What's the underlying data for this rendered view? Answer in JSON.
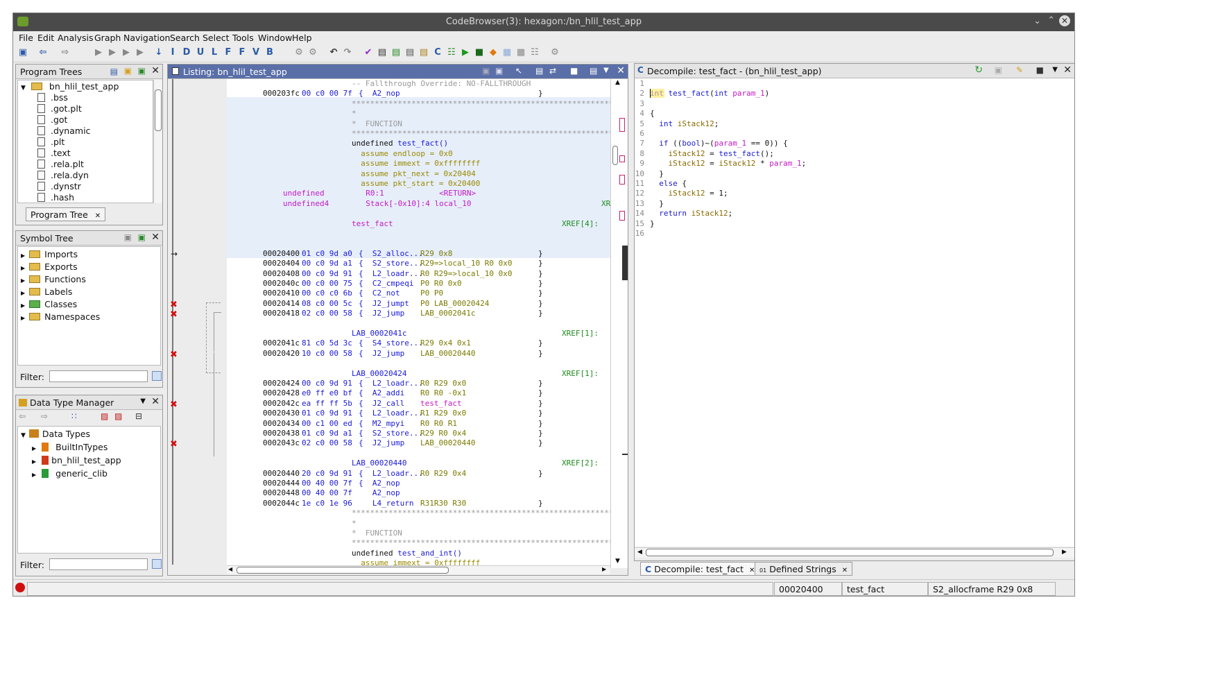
{
  "window": {
    "title": "CodeBrowser(3): hexagon:/bn_hlil_test_app"
  },
  "menu": [
    "File",
    "Edit",
    "Analysis",
    "Graph",
    "Navigation",
    "Search",
    "Select",
    "Tools",
    "Window",
    "Help"
  ],
  "program_trees": {
    "title": "Program Trees",
    "root": "bn_hlil_test_app",
    "items": [
      ".bss",
      ".got.plt",
      ".got",
      ".dynamic",
      ".plt",
      ".text",
      ".rela.plt",
      ".rela.dyn",
      ".dynstr",
      ".hash"
    ],
    "tab": "Program Tree"
  },
  "symbol_tree": {
    "title": "Symbol Tree",
    "items": [
      "Imports",
      "Exports",
      "Functions",
      "Labels",
      "Classes",
      "Namespaces"
    ],
    "filter_label": "Filter:"
  },
  "data_type_manager": {
    "title": "Data Type Manager",
    "root": "Data Types",
    "items": [
      "BuiltInTypes",
      "bn_hlil_test_app",
      "generic_clib"
    ],
    "filter_label": "Filter:"
  },
  "listing": {
    "title": "Listing:  bn_hlil_test_app",
    "lines": [
      {
        "a": "",
        "b": "",
        "m": "-- Fallthrough Override: NO-FALLTHROUGH",
        "o": "",
        "t": "gray"
      },
      {
        "a": "000203fc",
        "b": "00 c0 00 7f",
        "m": "{  A2_nop",
        "o": "",
        "t": "ins",
        "e": "}"
      },
      {
        "a": "",
        "b": "",
        "m": "**************************************************************",
        "o": "",
        "t": "star"
      },
      {
        "a": "",
        "b": "",
        "m": "*",
        "o": "",
        "t": "star"
      },
      {
        "a": "",
        "b": "",
        "m": "*  FUNCTION",
        "o": "",
        "t": "star"
      },
      {
        "a": "",
        "b": "",
        "m": "**************************************************************",
        "o": "",
        "t": "star"
      },
      {
        "a": "",
        "b": "",
        "m": "undefined test_fact()",
        "o": "",
        "t": "sig"
      },
      {
        "a": "",
        "b": "",
        "m": "  assume endloop = 0x0",
        "o": "",
        "t": "assume"
      },
      {
        "a": "",
        "b": "",
        "m": "  assume immext = 0xffffffff",
        "o": "",
        "t": "assume"
      },
      {
        "a": "",
        "b": "",
        "m": "  assume pkt_next = 0x20404",
        "o": "",
        "t": "assume"
      },
      {
        "a": "",
        "b": "",
        "m": "  assume pkt_start = 0x20400",
        "o": "",
        "t": "assume"
      },
      {
        "a": "",
        "b": "",
        "m": "undefined         R0:1            <RETURN>",
        "o": "",
        "t": "var"
      },
      {
        "a": "",
        "b": "",
        "m": "undefined4        Stack[-0x10]:4 local_10",
        "o": "XR",
        "t": "var"
      },
      {
        "a": "",
        "b": "",
        "m": "",
        "o": "",
        "t": "blank"
      },
      {
        "a": "",
        "b": "",
        "m": "test_fact",
        "o": "XREF[4]:",
        "t": "label"
      },
      {
        "a": "",
        "b": "",
        "m": "",
        "o": "",
        "t": "blank"
      },
      {
        "a": "",
        "b": "",
        "m": "",
        "o": "",
        "t": "blank"
      },
      {
        "a": "00020400",
        "b": "01 c0 9d a0",
        "m": "{  S2_alloc...",
        "o": "R29 0x8",
        "t": "ins",
        "e": "}"
      },
      {
        "a": "00020404",
        "b": "00 c0 9d a1",
        "m": "{  S2_store...",
        "o": "R29=>local_10 R0 0x0",
        "t": "ins",
        "e": "}"
      },
      {
        "a": "00020408",
        "b": "00 c0 9d 91",
        "m": "{  L2_loadr...",
        "o": "R0 R29=>local_10 0x0",
        "t": "ins",
        "e": "}"
      },
      {
        "a": "0002040c",
        "b": "00 c0 00 75",
        "m": "{  C2_cmpeqi",
        "o": "P0 R0 0x0",
        "t": "ins",
        "e": "}"
      },
      {
        "a": "00020410",
        "b": "00 c0 c0 6b",
        "m": "{  C2_not",
        "o": "P0 P0",
        "t": "ins",
        "e": "}"
      },
      {
        "a": "00020414",
        "b": "08 c0 00 5c",
        "m": "{  J2_jumpt",
        "o": "P0 LAB_00020424",
        "t": "ins",
        "e": "}"
      },
      {
        "a": "00020418",
        "b": "02 c0 00 58",
        "m": "{  J2_jump",
        "o": "LAB_0002041c",
        "t": "ins",
        "e": "}"
      },
      {
        "a": "",
        "b": "",
        "m": "",
        "o": "",
        "t": "blank"
      },
      {
        "a": "",
        "b": "",
        "m": "LAB_0002041c",
        "o": "XREF[1]:",
        "t": "label"
      },
      {
        "a": "0002041c",
        "b": "81 c0 5d 3c",
        "m": "{  S4_store...",
        "o": "R29 0x4 0x1",
        "t": "ins",
        "e": "}"
      },
      {
        "a": "00020420",
        "b": "10 c0 00 58",
        "m": "{  J2_jump",
        "o": "LAB_00020440",
        "t": "ins",
        "e": "}"
      },
      {
        "a": "",
        "b": "",
        "m": "",
        "o": "",
        "t": "blank"
      },
      {
        "a": "",
        "b": "",
        "m": "LAB_00020424",
        "o": "XREF[1]:",
        "t": "label"
      },
      {
        "a": "00020424",
        "b": "00 c0 9d 91",
        "m": "{  L2_loadr...",
        "o": "R0 R29 0x0",
        "t": "ins",
        "e": "}"
      },
      {
        "a": "00020428",
        "b": "e0 ff e0 bf",
        "m": "{  A2_addi",
        "o": "R0 R0 -0x1",
        "t": "ins",
        "e": "}"
      },
      {
        "a": "0002042c",
        "b": "ea ff ff 5b",
        "m": "{  J2_call",
        "o": "test_fact",
        "t": "call",
        "e": "}"
      },
      {
        "a": "00020430",
        "b": "01 c0 9d 91",
        "m": "{  L2_loadr...",
        "o": "R1 R29 0x0",
        "t": "ins",
        "e": "}"
      },
      {
        "a": "00020434",
        "b": "00 c1 00 ed",
        "m": "{  M2_mpyi",
        "o": "R0 R0 R1",
        "t": "ins",
        "e": "}"
      },
      {
        "a": "00020438",
        "b": "01 c0 9d a1",
        "m": "{  S2_store...",
        "o": "R29 R0 0x4",
        "t": "ins",
        "e": "}"
      },
      {
        "a": "0002043c",
        "b": "02 c0 00 58",
        "m": "{  J2_jump",
        "o": "LAB_00020440",
        "t": "ins",
        "e": "}"
      },
      {
        "a": "",
        "b": "",
        "m": "",
        "o": "",
        "t": "blank"
      },
      {
        "a": "",
        "b": "",
        "m": "LAB_00020440",
        "o": "XREF[2]:",
        "t": "label"
      },
      {
        "a": "00020440",
        "b": "20 c0 9d 91",
        "m": "{  L2_loadr...",
        "o": "R0 R29 0x4",
        "t": "ins",
        "e": "}"
      },
      {
        "a": "00020444",
        "b": "00 40 00 7f",
        "m": "{  A2_nop",
        "o": "",
        "t": "ins",
        "e": ""
      },
      {
        "a": "00020448",
        "b": "00 40 00 7f",
        "m": "   A2_nop",
        "o": "",
        "t": "ins",
        "e": ""
      },
      {
        "a": "0002044c",
        "b": "1e c0 1e 96",
        "m": "   L4_return",
        "o": "R31R30 R30",
        "t": "ins",
        "e": "}"
      },
      {
        "a": "",
        "b": "",
        "m": "**************************************************************",
        "o": "",
        "t": "star"
      },
      {
        "a": "",
        "b": "",
        "m": "*",
        "o": "",
        "t": "star"
      },
      {
        "a": "",
        "b": "",
        "m": "*  FUNCTION",
        "o": "",
        "t": "star"
      },
      {
        "a": "",
        "b": "",
        "m": "**************************************************************",
        "o": "",
        "t": "star"
      },
      {
        "a": "",
        "b": "",
        "m": "undefined test_and_int()",
        "o": "",
        "t": "sig2"
      },
      {
        "a": "",
        "b": "",
        "m": "  assume immext = 0xffffffff",
        "o": "",
        "t": "assume"
      }
    ]
  },
  "decompile": {
    "title": "Decompile: test_fact -  (bn_hlil_test_app)",
    "lines": [
      "",
      "int test_fact(int param_1)",
      "",
      "{",
      "  int iStack12;",
      "  ",
      "  if ((bool)~(param_1 == 0)) {",
      "    iStack12 = test_fact();",
      "    iStack12 = iStack12 * param_1;",
      "  }",
      "  else {",
      "    iStack12 = 1;",
      "  }",
      "  return iStack12;",
      "}",
      ""
    ]
  },
  "bottom_tabs": [
    "Decompile: test_fact",
    "Defined Strings"
  ],
  "status": {
    "address": "00020400",
    "function": "test_fact",
    "instruction": "S2_allocframe R29 0x8"
  }
}
